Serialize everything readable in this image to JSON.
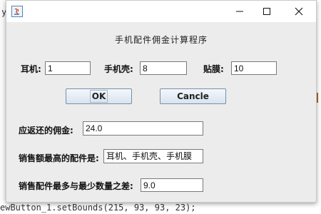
{
  "window": {
    "title": "",
    "controls": [
      "minimize",
      "maximize",
      "close"
    ]
  },
  "form": {
    "heading": "手机配件佣金计算程序",
    "earphone": {
      "label": "耳机:",
      "value": "1"
    },
    "phone_case": {
      "label": "手机壳:",
      "value": "8"
    },
    "film": {
      "label": "贴膜:",
      "value": "10"
    },
    "ok_label": "OK",
    "cancel_label": "Cancle",
    "commission": {
      "label": "应返还的佣金:",
      "value": "24.0"
    },
    "top_seller": {
      "label": "销售额最高的配件是:",
      "value": "耳机、手机壳、手机膜"
    },
    "qty_diff": {
      "label": "销售配件最多与最少数量之差:",
      "value": "9.0"
    }
  },
  "background": {
    "top_left_fragment": "y.",
    "bottom_code": "ewButton_1.setBounds(215, 93, 93, 23);"
  },
  "colors": {
    "titlebar": "#ffffff",
    "window_bg": "#ececec",
    "button_gradient_top": "#f4f8fc",
    "button_gradient_bottom": "#d7e3ef"
  }
}
